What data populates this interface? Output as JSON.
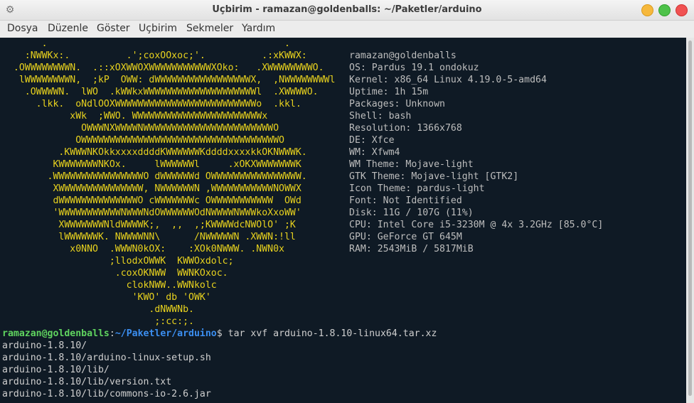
{
  "window": {
    "title": "Uçbirim - ramazan@goldenballs: ~/Paketler/arduino",
    "gear_icon": "gear-icon",
    "colors": {
      "minimize": "#f6b83c",
      "maximize": "#4ec24a",
      "close": "#f05252",
      "terminal_bg": "#0f1a25",
      "ascii": "#e8d21e",
      "prompt_user": "#5fd35f",
      "prompt_path": "#3b8ef0"
    }
  },
  "menu": [
    "Dosya",
    "Düzenle",
    "Göster",
    "Uçbirim",
    "Sekmeler",
    "Yardım"
  ],
  "ascii_art": [
    "       .                                          .",
    "    :NWWKx:.          .';coxOOxoc;'.          .:xKWWX:",
    "  .OWWWWWWWWN.  .::xOXWWOXWWWWWWWWWWWXOko:   .XWWWWWWWWO.",
    "   lWWWWWWWWN,  ;kP  OWW: dWWWWWWWWWWWWWWWWWX,  ,NWWWWWWWWl",
    "    .OWWWWN.  lWO  .kWWkxWWWWWWWWWWWWWWWWWWWWl  .XWWWWO.",
    "      .lkk.  oNdlOOXWWWWWWWWWWWWWWWWWWWWWWWWWo  .kkl.",
    "            xWk  ;WWO. WWWWWWWWWWWWWWWWWWWWWWWx",
    "              OWWWNXWWWWNWWWWWWWWWWWWWWWWWWWWWWWO",
    "             OWWWWWWWWWWWWWWWWWWWWWWWWWWWWWWWWWWWO",
    "          .KWWWNKOkkxxxxddddKWWWWWWKddddxxxxkkOKNWWWK.",
    "         KWWWWWWWNKOx.     lWWWWWWl     .xOKXWWWWWWWK",
    "        .WWWWWWWWWWWWWWWWO dWWWWWWd OWWWWWWWWWWWWWWWW.",
    "         XWWWWWWWWWWWWWWW, NWWWWWWN ,WWWWWWWWWWWNOWWX",
    "         dWWWWWWWWWWWWWWO cWWWWWWWc OWWWWWWWWWWW  OWd",
    "         'WWWWWWWWWWWNWWWNdOWWWWWWOdNWWWWNWWWkoXxoWW'",
    "          XWWWWWWWNldWWWWK;,  ,,  ,;KWWWWdcNWOlO' ;K",
    "          lWWWWWWK. NWWWWNN\\      /NWWWWWN .XWWN:!ll",
    "            x0NNO  .WWWN0kOX:    :XOk0NWWW. .NWN0x",
    "                   ;llodxOWWK  KWWOxdolc;",
    "                    .coxOKNWW  WWNKOxoc.",
    "                      clokNWW..WWNkolc",
    "                       'KWO' db 'OWK'",
    "                          .dNWWNb.",
    "                           ;:cc:;."
  ],
  "sysinfo": [
    "ramazan@goldenballs",
    "OS: Pardus 19.1 ondokuz",
    "Kernel: x86_64 Linux 4.19.0-5-amd64",
    "Uptime: 1h 15m",
    "Packages: Unknown",
    "Shell: bash",
    "Resolution: 1366x768",
    "DE: Xfce",
    "WM: Xfwm4",
    "WM Theme: Mojave-light",
    "GTK Theme: Mojave-light [GTK2]",
    "Icon Theme: pardus-light",
    "Font: Not Identified",
    "Disk: 11G / 107G (11%)",
    "CPU: Intel Core i5-3230M @ 4x 3.2GHz [85.0°C]",
    "GPU: GeForce GT 645M",
    "RAM: 2543MiB / 5817MiB"
  ],
  "prompt": {
    "user_host": "ramazan@goldenballs",
    "sep": ":",
    "path": "~/Paketler/arduino",
    "dollar": "$ ",
    "command": "tar xvf arduino-1.8.10-linux64.tar.xz"
  },
  "output": [
    "arduino-1.8.10/",
    "arduino-1.8.10/arduino-linux-setup.sh",
    "arduino-1.8.10/lib/",
    "arduino-1.8.10/lib/version.txt",
    "arduino-1.8.10/lib/commons-io-2.6.jar"
  ]
}
